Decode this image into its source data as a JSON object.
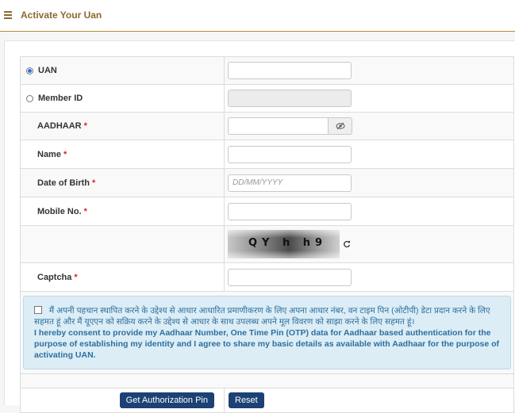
{
  "header": {
    "title": "Activate Your Uan"
  },
  "form": {
    "uan_label": "UAN",
    "member_id_label": "Member ID",
    "aadhaar_label": "AADHAAR",
    "name_label": "Name",
    "dob_label": "Date of Birth",
    "dob_placeholder": "DD/MM/YYYY",
    "mobile_label": "Mobile No.",
    "captcha_label": "Captcha",
    "captcha_text": "QY h h9",
    "required_mark": "*",
    "selected_option": "UAN"
  },
  "consent": {
    "hindi_text": "मैं अपनी पहचान स्थापित करने के उद्देश्य से आधार आधारित प्रमाणीकरण के लिए अपना आधार नंबर, वन टाइम पिन (ओटीपी) डेटा प्रदान करने के लिए सहमत हूं और मैं यूएएन को सक्रिय करने के उद्देश्य से आधार के साथ उपलब्ध अपने मूल विवरण को साझा करने के लिए सहमत हूं।",
    "english_text": "I hereby consent to provide my Aadhaar Number, One Time Pin (OTP) data for Aadhaar based authentication for the purpose of establishing my identity and I agree to share my basic details as available with Aadhaar for the purpose of activating UAN."
  },
  "buttons": {
    "get_pin": "Get Authorization Pin",
    "reset": "Reset"
  },
  "colors": {
    "accent": "#8a6a2e",
    "button": "#1c4174",
    "consent_bg": "#dcedf5",
    "required": "#d9262a"
  }
}
